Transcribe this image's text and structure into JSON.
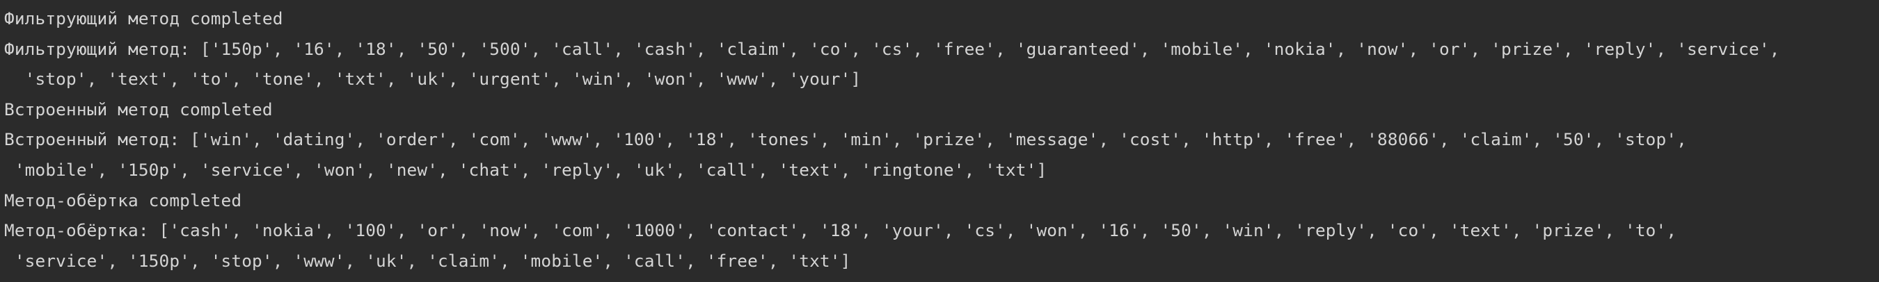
{
  "console": {
    "lines": [
      "Фильтрующий метод completed",
      "Фильтрующий метод: ['150p', '16', '18', '50', '500', 'call', 'cash', 'claim', 'co', 'cs', 'free', 'guaranteed', 'mobile', 'nokia', 'now', 'or', 'prize', 'reply', 'service',",
      "  'stop', 'text', 'to', 'tone', 'txt', 'uk', 'urgent', 'win', 'won', 'www', 'your']",
      "Встроенный метод completed",
      "Встроенный метод: ['win', 'dating', 'order', 'com', 'www', '100', '18', 'tones', 'min', 'prize', 'message', 'cost', 'http', 'free', '88066', 'claim', '50', 'stop',",
      " 'mobile', '150p', 'service', 'won', 'new', 'chat', 'reply', 'uk', 'call', 'text', 'ringtone', 'txt']",
      "Метод-обёртка completed",
      "Метод-обёртка: ['cash', 'nokia', '100', 'or', 'now', 'com', '1000', 'contact', '18', 'your', 'cs', 'won', '16', '50', 'win', 'reply', 'co', 'text', 'prize', 'to',",
      " 'service', '150p', 'stop', 'www', 'uk', 'claim', 'mobile', 'call', 'free', 'txt']"
    ]
  }
}
